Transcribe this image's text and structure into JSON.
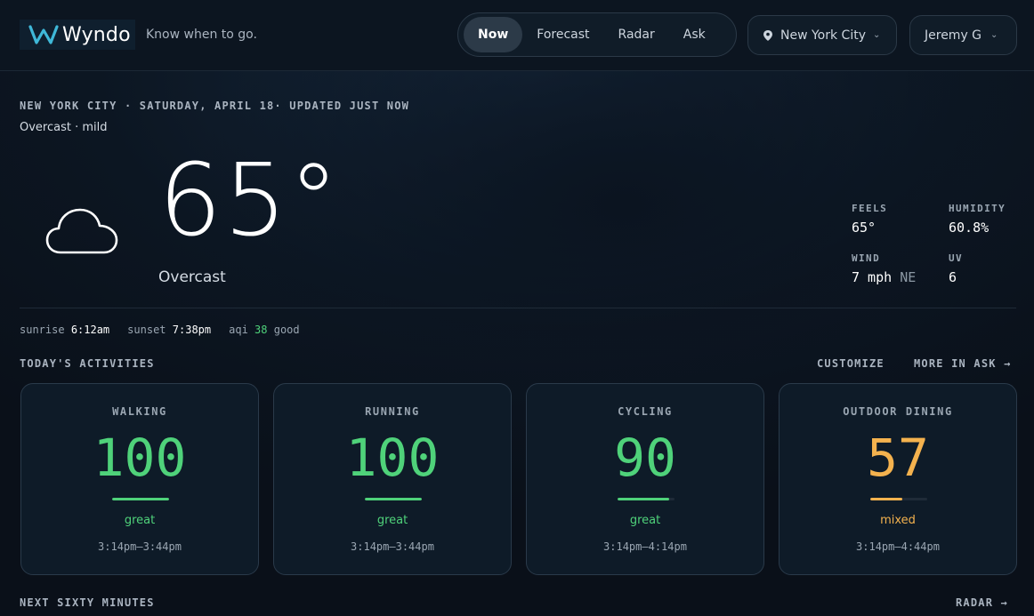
{
  "brand": {
    "name": "Wyndo",
    "tagline": "Know when to go."
  },
  "nav": {
    "tabs": [
      "Now",
      "Forecast",
      "Radar",
      "Ask"
    ],
    "active": "Now"
  },
  "location": {
    "label": "New York City"
  },
  "user": {
    "name": "Jeremy G"
  },
  "header": {
    "dateline": "NEW YORK CITY · SATURDAY, APRIL 18· UPDATED JUST NOW",
    "subcondition": "Overcast · mild"
  },
  "current": {
    "temp": "65°",
    "condition": "Overcast",
    "icon": "cloud-icon"
  },
  "stats": {
    "feels": {
      "label": "FEELS",
      "value": "65°"
    },
    "humidity": {
      "label": "HUMIDITY",
      "value": "60.8%"
    },
    "wind": {
      "label": "WIND",
      "value": "7 mph",
      "dir": "NE"
    },
    "uv": {
      "label": "UV",
      "value": "6"
    }
  },
  "sun": {
    "sunrise_label": "sunrise",
    "sunrise": "6:12am",
    "sunset_label": "sunset",
    "sunset": "7:38pm",
    "aqi_label": "aqi",
    "aqi": "38",
    "aqi_desc": "good"
  },
  "activities": {
    "title": "TODAY'S ACTIVITIES",
    "customize": "CUSTOMIZE",
    "more": "MORE IN ASK →",
    "cards": [
      {
        "title": "WALKING",
        "score": "100",
        "level": 1.0,
        "verdict": "great",
        "time": "3:14pm–3:44pm",
        "color": "#4fd27a"
      },
      {
        "title": "RUNNING",
        "score": "100",
        "level": 1.0,
        "verdict": "great",
        "time": "3:14pm–3:44pm",
        "color": "#4fd27a"
      },
      {
        "title": "CYCLING",
        "score": "90",
        "level": 0.9,
        "verdict": "great",
        "time": "3:14pm–4:14pm",
        "color": "#4fd27a"
      },
      {
        "title": "OUTDOOR DINING",
        "score": "57",
        "level": 0.57,
        "verdict": "mixed",
        "time": "3:14pm–4:44pm",
        "color": "#f4b24e"
      }
    ]
  },
  "next": {
    "title": "NEXT SIXTY MINUTES",
    "radar": "RADAR →"
  },
  "colors": {
    "accent_good": "#4fd27a",
    "accent_mixed": "#f4b24e",
    "logo": "#3fb8d8"
  }
}
